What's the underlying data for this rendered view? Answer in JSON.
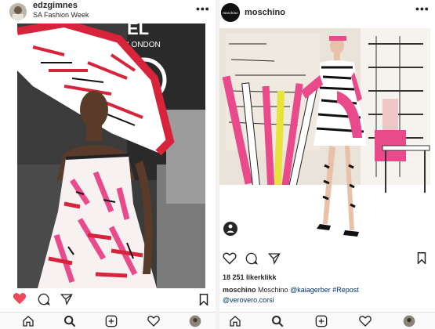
{
  "left_post": {
    "username": "edzgimnes",
    "location": "SA Fashion Week",
    "more_label": "•••",
    "backdrop_text": [
      "EL",
      "LONDON"
    ],
    "liked": true,
    "tabs": [
      "home-icon",
      "search-icon",
      "new-post-icon",
      "activity-icon",
      "profile-icon"
    ]
  },
  "right_post": {
    "username": "moschino",
    "avatar_text": "moschino",
    "more_label": "•••",
    "likes": "18 251 likerklikk",
    "caption_user": "moschino",
    "caption_text": "Moschino",
    "caption_mention": "@kaiagerber",
    "caption_hashtag": "#Repost",
    "caption_line2": "@verovero.corsi",
    "tabs": [
      "home-icon",
      "search-icon",
      "new-post-icon",
      "activity-icon",
      "profile-icon"
    ]
  },
  "colors": {
    "like_red": "#ed4956",
    "dress_pink": "#e94a8b",
    "link_blue": "#003569"
  }
}
